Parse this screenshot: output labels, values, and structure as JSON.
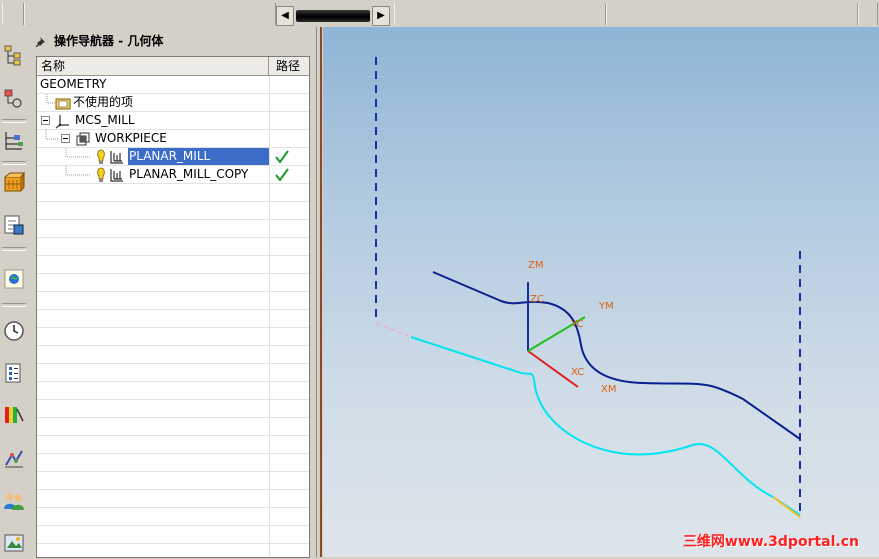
{
  "navigator": {
    "title": "操作导航器 - 几何体",
    "columns": {
      "name": "名称",
      "path": "路径"
    },
    "rows": [
      {
        "label": "GEOMETRY"
      },
      {
        "label": "不使用的项"
      },
      {
        "label": "MCS_MILL"
      },
      {
        "label": "WORKPIECE"
      },
      {
        "label": "PLANAR_MILL",
        "path_status": "ok",
        "selected": true
      },
      {
        "label": "PLANAR_MILL_COPY",
        "path_status": "ok"
      }
    ]
  },
  "viewport": {
    "labels": {
      "zm": "ZM",
      "zc": "ZC",
      "ym": "YM",
      "yc": "YC",
      "xc": "XC",
      "xm": "XM"
    },
    "colors": {
      "tool_path": "#0a1f8f",
      "cut_path": "#00e5f0",
      "x_axis": "#e02020",
      "y_axis": "#20c020",
      "z_axis": "#1030a0",
      "label_color": "#e06010",
      "end_segment": "#f5c020"
    }
  },
  "watermark": "三维网www.3dportal.cn"
}
